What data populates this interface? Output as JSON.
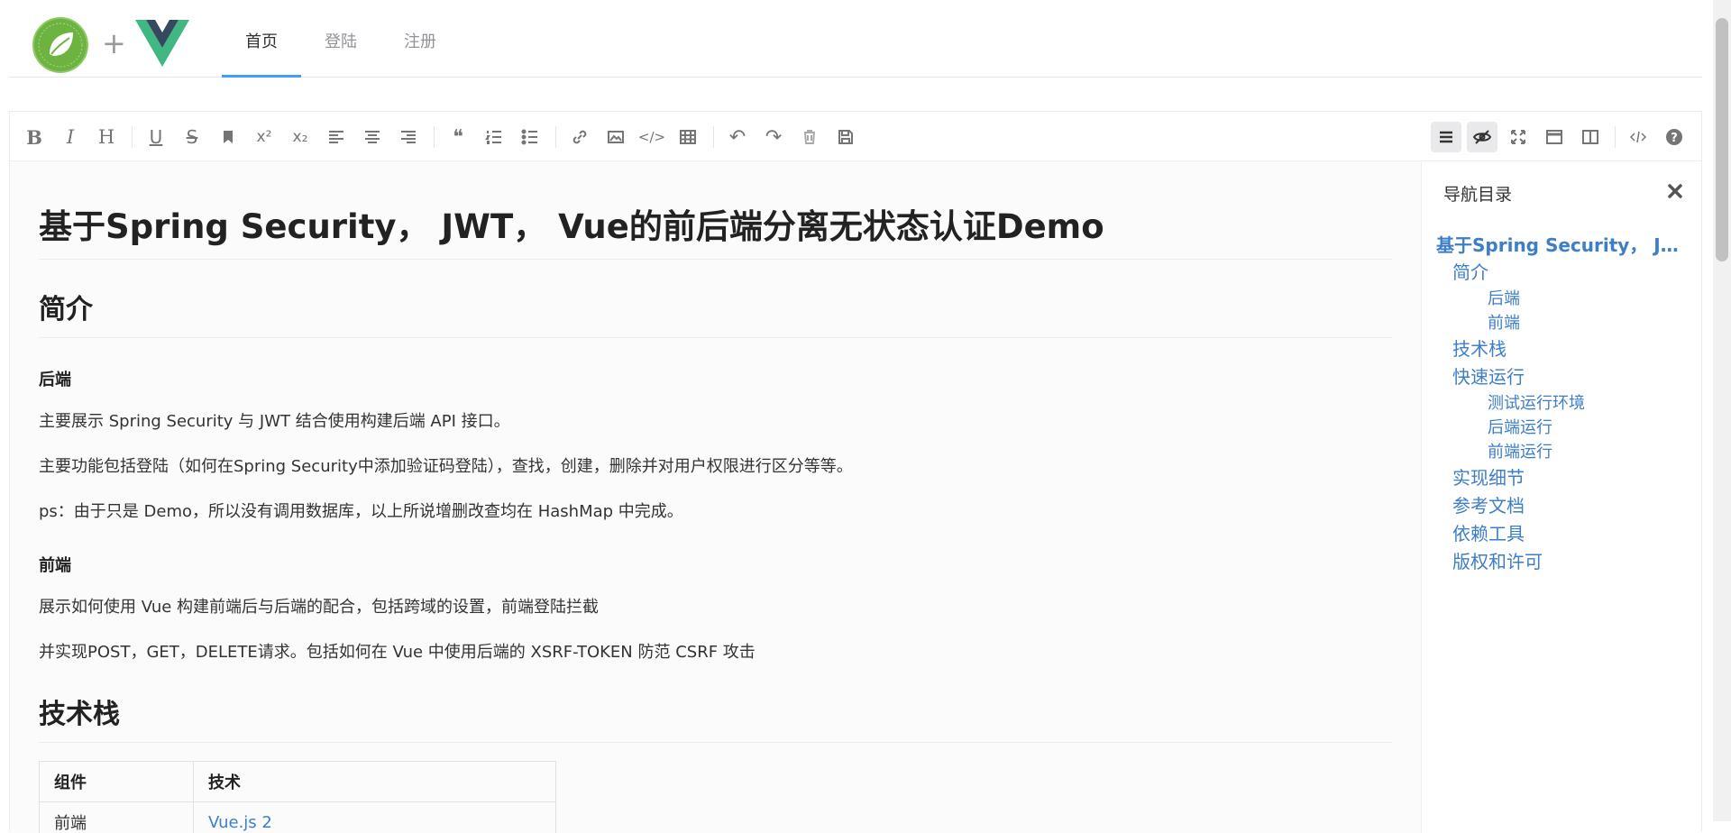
{
  "header": {
    "plus": "+",
    "nav": [
      {
        "label": "首页",
        "active": true
      },
      {
        "label": "登陆",
        "active": false
      },
      {
        "label": "注册",
        "active": false
      }
    ]
  },
  "toolbar": {
    "left": [
      {
        "icon": "bold-icon",
        "glyph": "B"
      },
      {
        "icon": "italic-icon",
        "glyph": "I"
      },
      {
        "icon": "heading-icon",
        "glyph": "H"
      },
      {
        "icon": "underline-icon",
        "glyph": "U"
      },
      {
        "icon": "strikethrough-icon",
        "glyph": "S"
      },
      {
        "icon": "bookmark-icon",
        "glyph": ""
      },
      {
        "icon": "superscript-icon",
        "glyph": "x²"
      },
      {
        "icon": "subscript-icon",
        "glyph": "x₂"
      },
      {
        "icon": "align-left-icon",
        "glyph": ""
      },
      {
        "icon": "align-center-icon",
        "glyph": ""
      },
      {
        "icon": "align-right-icon",
        "glyph": ""
      },
      {
        "icon": "quote-icon",
        "glyph": "❝"
      },
      {
        "icon": "ordered-list-icon",
        "glyph": ""
      },
      {
        "icon": "unordered-list-icon",
        "glyph": ""
      },
      {
        "icon": "link-icon",
        "glyph": ""
      },
      {
        "icon": "image-icon",
        "glyph": ""
      },
      {
        "icon": "code-icon",
        "glyph": "</>"
      },
      {
        "icon": "table-icon",
        "glyph": ""
      },
      {
        "icon": "undo-icon",
        "glyph": "↶"
      },
      {
        "icon": "redo-icon",
        "glyph": "↷"
      },
      {
        "icon": "trash-icon",
        "glyph": ""
      },
      {
        "icon": "save-icon",
        "glyph": ""
      }
    ],
    "right": [
      {
        "icon": "navigation-icon",
        "selected": true
      },
      {
        "icon": "preview-toggle-icon",
        "selected": true
      },
      {
        "icon": "fullscreen-icon",
        "selected": false
      },
      {
        "icon": "window-icon",
        "selected": false
      },
      {
        "icon": "split-view-icon",
        "selected": false
      },
      {
        "icon": "html-code-icon",
        "selected": false
      },
      {
        "icon": "help-icon",
        "selected": false
      }
    ]
  },
  "doc": {
    "title": "基于Spring Security， JWT， Vue的前后端分离无状态认证Demo",
    "intro_heading": "简介",
    "backend_heading": "后端",
    "backend_p1": "主要展示 Spring Security 与 JWT 结合使用构建后端 API 接口。",
    "backend_p2": "主要功能包括登陆（如何在Spring Security中添加验证码登陆），查找，创建，删除并对用户权限进行区分等等。",
    "backend_p3": "ps：由于只是 Demo，所以没有调用数据库，以上所说增删改查均在 HashMap 中完成。",
    "frontend_heading": "前端",
    "frontend_p1": "展示如何使用 Vue 构建前端后与后端的配合，包括跨域的设置，前端登陆拦截",
    "frontend_p2": "并实现POST，GET，DELETE请求。包括如何在 Vue 中使用后端的 XSRF-TOKEN 防范 CSRF 攻击",
    "tech_heading": "技术栈",
    "table": {
      "headers": [
        "组件",
        "技术"
      ],
      "rows": [
        [
          "前端",
          "Vue.js 2"
        ]
      ]
    }
  },
  "toc": {
    "title": "导航目录",
    "items": [
      {
        "label": "基于Spring Security， JWT， Vue的前后端分离无状态认证Demo",
        "level": 1
      },
      {
        "label": "简介",
        "level": 2
      },
      {
        "label": "后端",
        "level": 3
      },
      {
        "label": "前端",
        "level": 3
      },
      {
        "label": "技术栈",
        "level": 2
      },
      {
        "label": "快速运行",
        "level": 2
      },
      {
        "label": "测试运行环境",
        "level": 3
      },
      {
        "label": "后端运行",
        "level": 3
      },
      {
        "label": "前端运行",
        "level": 3
      },
      {
        "label": "实现细节",
        "level": 2
      },
      {
        "label": "参考文档",
        "level": 2
      },
      {
        "label": "依赖工具",
        "level": 2
      },
      {
        "label": "版权和许可",
        "level": 2
      }
    ]
  },
  "colors": {
    "accent": "#409eff",
    "link": "#3d7ec9",
    "spring_green": "#6db33f",
    "vue_green": "#41b883",
    "vue_dark": "#35495e"
  }
}
